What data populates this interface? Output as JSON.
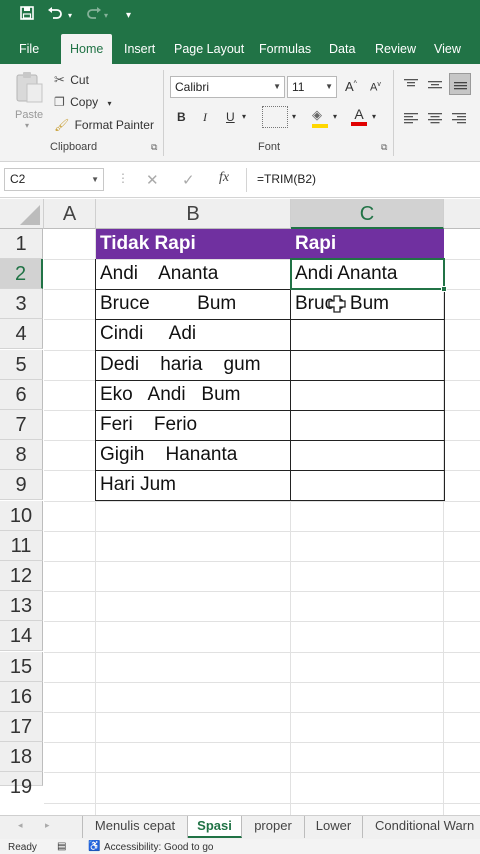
{
  "qat": {
    "save_icon": "save-icon",
    "undo_icon": "undo-icon",
    "redo_icon": "redo-icon",
    "customize_icon": "customize-qat-icon"
  },
  "tabs": [
    {
      "label": "File"
    },
    {
      "label": "Home",
      "active": true
    },
    {
      "label": "Insert"
    },
    {
      "label": "Page Layout"
    },
    {
      "label": "Formulas"
    },
    {
      "label": "Data"
    },
    {
      "label": "Review"
    },
    {
      "label": "View"
    }
  ],
  "ribbon": {
    "clipboard": {
      "paste": "Paste",
      "cut": "Cut",
      "copy": "Copy",
      "format_painter": "Format Painter",
      "group_label": "Clipboard"
    },
    "font": {
      "name": "Calibri",
      "size": "11",
      "bold": "B",
      "italic": "I",
      "underline": "U",
      "grow": "A",
      "shrink": "A",
      "font_color": "A",
      "group_label": "Font"
    }
  },
  "formula_bar": {
    "name_box": "C2",
    "cancel": "✕",
    "enter": "✓",
    "fx": "fx",
    "formula": "=TRIM(B2)"
  },
  "columns": [
    "A",
    "B",
    "C"
  ],
  "rows": [
    "1",
    "2",
    "3",
    "4",
    "5",
    "6",
    "7",
    "8",
    "9",
    "10",
    "11",
    "12",
    "13",
    "14",
    "15",
    "16",
    "17",
    "18",
    "19"
  ],
  "cells": {
    "B1": "Tidak Rapi",
    "C1": "Rapi",
    "B2": "Andi    Ananta",
    "B3": "Bruce         Bum",
    "B4": "Cindi     Adi",
    "B5": "Dedi    haria    gum",
    "B6": "Eko   Andi   Bum",
    "B7": "Feri    Ferio",
    "B8": "Gigih    Hananta",
    "B9": "Hari Jum",
    "C2": "Andi Ananta",
    "C3": "Bruce Bum"
  },
  "header_fill": "#7030a0",
  "accent": "#217346",
  "sheet_tabs": [
    {
      "label": "Menulis cepat"
    },
    {
      "label": "Spasi",
      "active": true
    },
    {
      "label": "proper"
    },
    {
      "label": "Lower"
    },
    {
      "label": "Conditional Warn"
    }
  ],
  "status": {
    "ready": "Ready",
    "accessibility": "Accessibility: Good to go"
  }
}
